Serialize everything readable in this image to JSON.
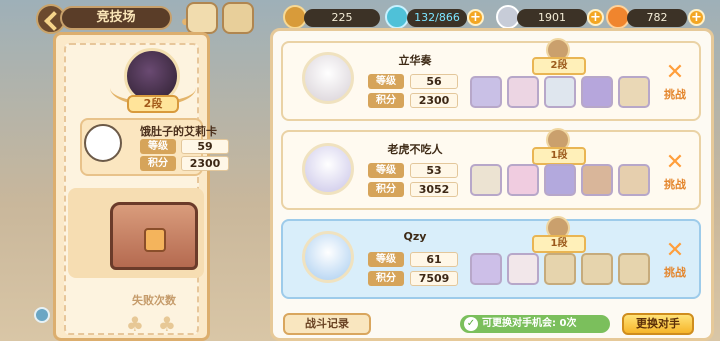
{
  "header": {
    "title": "竞技场",
    "resources": [
      {
        "icon": "coin-icon",
        "value": "225"
      },
      {
        "icon": "stamina-potion-icon",
        "value": "132/866"
      },
      {
        "icon": "gem-icon",
        "value": "1901"
      },
      {
        "icon": "carrot-icon",
        "value": "782"
      }
    ]
  },
  "player": {
    "rank": "2段",
    "name": "饿肚子的艾莉卡",
    "level_label": "等级",
    "level": "59",
    "score_label": "积分",
    "score": "2300",
    "fail_title": "失败次数"
  },
  "opponents": [
    {
      "name": "立华奏",
      "level": "56",
      "score": "2300",
      "tier": "2段",
      "challenge": "挑战",
      "level_label": "等级",
      "score_label": "积分"
    },
    {
      "name": "老虎不吃人",
      "level": "53",
      "score": "3052",
      "tier": "1段",
      "challenge": "挑战",
      "level_label": "等级",
      "score_label": "积分"
    },
    {
      "name": "Qzy",
      "level": "61",
      "score": "7509",
      "tier": "1段",
      "challenge": "挑战",
      "level_label": "等级",
      "score_label": "积分"
    }
  ],
  "footer": {
    "battle_record": "战斗记录",
    "chance_text": "可更换对手机会: 0次",
    "change_opponent": "更换对手"
  },
  "colors": {
    "accent_orange": "#f3a623",
    "panel_bg": "#fbe9c9",
    "chance_green": "#7bbf5c",
    "my_row_blue": "#d9eefa"
  }
}
